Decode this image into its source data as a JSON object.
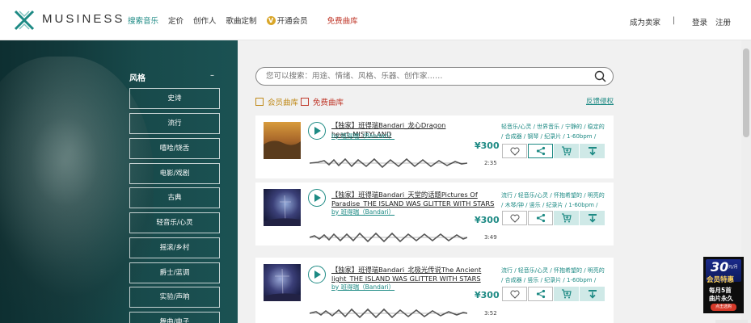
{
  "header": {
    "brand": "MUSINESS",
    "nav": [
      "搜索音乐",
      "定价",
      "创作人",
      "歌曲定制"
    ],
    "vip_label": "开通会员",
    "vip_badge": "V",
    "free_label": "免费曲库",
    "become_seller": "成为卖家",
    "separator": "|",
    "login": "登录",
    "register": "注册"
  },
  "sidebar": {
    "title": "风格",
    "collapse": "–",
    "items": [
      "史诗",
      "流行",
      "嘻哈/饶舌",
      "电影/戏剧",
      "古典",
      "轻音乐/心灵",
      "摇滚/乡村",
      "爵士/蓝调",
      "实验/声响",
      "舞曲/电子"
    ]
  },
  "search": {
    "placeholder": "您可以搜索：用途、情绪、风格、乐器、创作家……"
  },
  "filters": {
    "member": "会员曲库",
    "free": "免费曲库",
    "feedback": "反馈侵权"
  },
  "songs": [
    {
      "title": "【独家】班得瑞Bandari_龙心Dragon heart_MISTYLAND",
      "artist": "by 班得瑞（Bandari）",
      "price": "¥300",
      "duration": "2:35",
      "tags": "轻音乐/心灵 / 世界音乐 / 宁静的 / 稳定的 / 合成器 / 钢琴 / 纪录片 / 1-60bpm /"
    },
    {
      "title": "【独家】班得瑞Bandari_天堂的话题Pictures Of Paradise_THE ISLAND WAS GLITTER WITH STARS",
      "artist": "by 班得瑞（Bandari）",
      "price": "¥300",
      "duration": "3:49",
      "tags": "流行 / 轻音乐/心灵 / 怀抱希望的 / 明亮的 / 木琴/钟 / 竖乐 / 纪录片 / 1-60bpm /"
    },
    {
      "title": "【独家】班得瑞Bandari_北极光传说The Ancient light_THE ISLAND WAS GLITTER WITH STARS",
      "artist": "by 班得瑞（Bandari）",
      "price": "¥300",
      "duration": "3:52",
      "tags": "流行 / 轻音乐/心灵 / 怀抱希望的 / 明亮的 / 合成器 / 竖乐 / 纪录片 / 1-60bpm /"
    }
  ],
  "promo": {
    "line1": "30",
    "line1_unit": "元/月",
    "line2": "会员特惠",
    "line3": "每月5首",
    "line4": "曲片永久",
    "line5": "点击选购"
  },
  "colors": {
    "accent": "#1d8a84",
    "free": "#c0392b",
    "vip": "#b38a1c",
    "sidebar": "#143f41"
  },
  "icons": [
    "logo-x-icon",
    "search-icon",
    "heart-icon",
    "share-icon",
    "cart-icon",
    "download-icon",
    "play-icon"
  ]
}
